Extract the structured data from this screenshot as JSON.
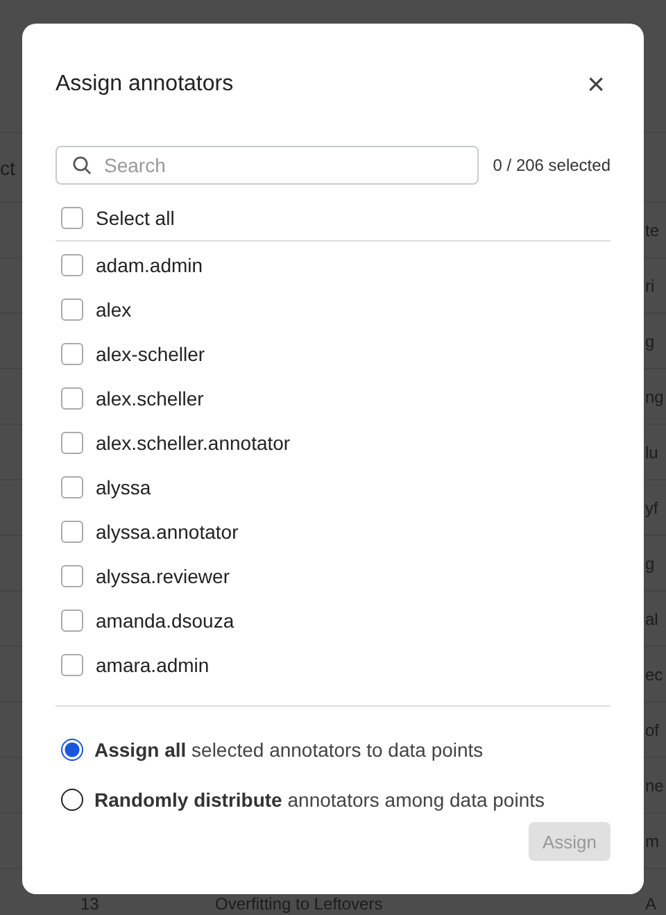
{
  "background_table": {
    "header": {
      "column_1": "ct"
    },
    "rows": [
      {
        "column_3": "te"
      },
      {
        "column_3": "ri"
      },
      {
        "column_3": "g"
      },
      {
        "column_3": "ng"
      },
      {
        "column_3": "lu"
      },
      {
        "column_3": "yf"
      },
      {
        "column_3": "g"
      },
      {
        "column_3": "al"
      },
      {
        "column_3": "ec"
      },
      {
        "column_3": "of"
      },
      {
        "column_3": "ne"
      },
      {
        "column_3": "m"
      },
      {
        "column_1": "13",
        "column_2": "Overfitting to Leftovers",
        "column_3": "A"
      }
    ]
  },
  "dialog": {
    "title": "Assign annotators",
    "close": "×",
    "search": {
      "placeholder": "Search"
    },
    "count": "0 / 206 selected",
    "select_all": {
      "label": "Select all",
      "checked": false
    },
    "annotators": [
      {
        "name": "adam.admin",
        "checked": false
      },
      {
        "name": "alex",
        "checked": false
      },
      {
        "name": "alex-scheller",
        "checked": false
      },
      {
        "name": "alex.scheller",
        "checked": false
      },
      {
        "name": "alex.scheller.annotator",
        "checked": false
      },
      {
        "name": "alyssa",
        "checked": false
      },
      {
        "name": "alyssa.annotator",
        "checked": false
      },
      {
        "name": "alyssa.reviewer",
        "checked": false
      },
      {
        "name": "amanda.dsouza",
        "checked": false
      },
      {
        "name": "amara.admin",
        "checked": false
      }
    ],
    "modes": [
      {
        "label": "**Assign all** selected annotators to data points",
        "selected": true
      },
      {
        "label": "**Randomly distribute** annotators among data points",
        "selected": false
      }
    ],
    "assign_button": {
      "label": "Assign",
      "disabled": true
    }
  }
}
